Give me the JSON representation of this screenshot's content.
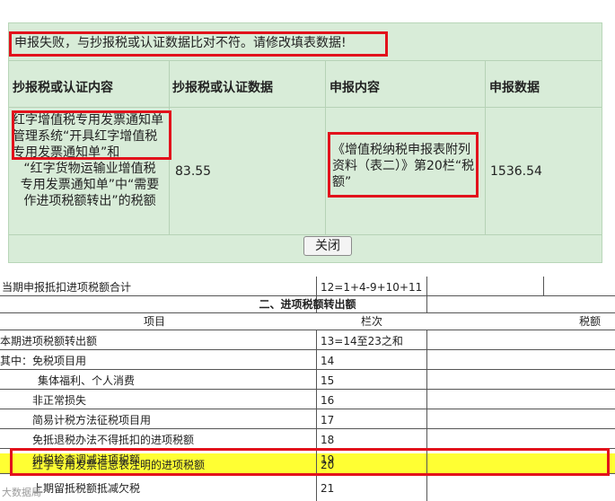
{
  "dialog": {
    "message": "申报失败，与抄报税或认证数据比对不符。请修改填表数据!",
    "headers": [
      "抄报税或认证内容",
      "抄报税或认证数据",
      "申报内容",
      "申报数据"
    ],
    "row_content_part1": "红字增值税专用发票通知单管理系统“开具红字增值税专用发票通知单”和",
    "row_content_part2": "“红字货物运输业增值税专用发票通知单”中“需要作进项税额转出”的税额",
    "row_value": "83.55",
    "declare_content": "《增值税纳税申报表附列资料（表二）》第20栏“税额”",
    "declare_value": "1536.54",
    "close_label": "关闭"
  },
  "table": {
    "top_row": {
      "item": "当期申报抵扣进项税额合计",
      "col": "12=1+4-9+10+11"
    },
    "section_title": "二、进项税额转出额",
    "col_headers": {
      "item": "项目",
      "col": "栏次",
      "tax": "税额"
    },
    "rows": [
      {
        "item": "本期进项税额转出额",
        "col": "13=14至23之和"
      },
      {
        "item": "其中：免税项目用",
        "col": "14"
      },
      {
        "item": "集体福利、个人消费",
        "col": "15"
      },
      {
        "item": "非正常损失",
        "col": "16"
      },
      {
        "item": "简易计税方法征税项目用",
        "col": "17"
      },
      {
        "item": "免抵退税办法不得抵扣的进项税额",
        "col": "18"
      },
      {
        "item": "纳税检查调减进项税额",
        "col": "19"
      },
      {
        "item": "红字专用发票信息表注明的进项税额",
        "col": "20"
      },
      {
        "item": "上期留抵税额抵减欠税",
        "col": "21"
      }
    ]
  },
  "watermark": "大数据局",
  "colors": {
    "highlight": "#ffff33",
    "annotation": "#e2121c",
    "dialog_bg": "#d8ecd8"
  }
}
